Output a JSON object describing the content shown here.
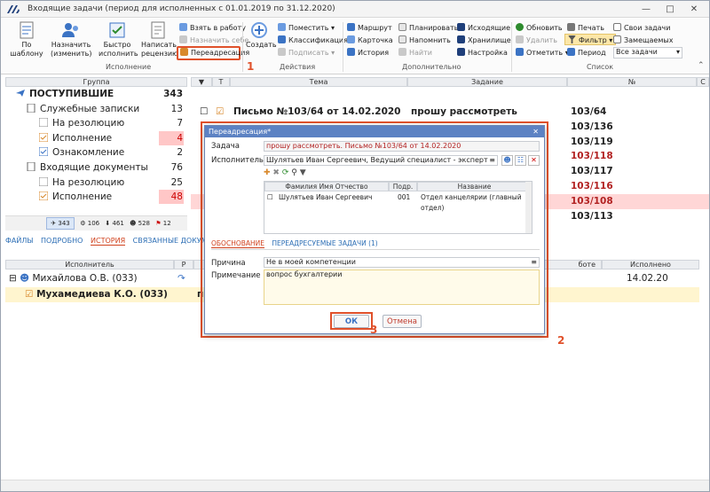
{
  "window": {
    "title": "Входящие задачи (период для исполненных с 01.01.2019 по 31.12.2020)"
  },
  "ribbon": {
    "execution": {
      "group_label": "Исполнение",
      "by_template": "По шаблону",
      "assign": "Назначить (изменить)",
      "quick_exec": "Быстро исполнить",
      "write_review": "Написать рецензию",
      "take_to_work": "Взять в работу",
      "assign_self": "Назначить себе",
      "readdress": "Переадресация"
    },
    "actions": {
      "group_label": "Действия",
      "create": "Создать",
      "place": "Поместить",
      "classify": "Классификация",
      "sign": "Подписать"
    },
    "additional": {
      "group_label": "Дополнительно",
      "route": "Маршрут",
      "card": "Карточка",
      "history": "История",
      "plan": "Планировать",
      "remind": "Напомнить",
      "find": "Найти",
      "outgoing": "Исходящие",
      "storage": "Хранилище",
      "settings": "Настройка"
    },
    "list": {
      "group_label": "Список",
      "refresh": "Обновить",
      "delete": "Удалить",
      "mark": "Отметить",
      "print": "Печать",
      "filter": "Фильтр",
      "period": "Период",
      "own_tasks": "Свои задачи",
      "substitutes": "Замещаемых",
      "all_tasks": "Все задачи"
    },
    "markers": {
      "one": "1",
      "two": "2",
      "three": "3"
    }
  },
  "tree": {
    "header": "Группа",
    "rows": [
      {
        "label": "ПОСТУПИВШИЕ",
        "count": "343"
      },
      {
        "label": "Служебные записки",
        "count": "13"
      },
      {
        "label": "На резолюцию",
        "count": "7"
      },
      {
        "label": "Исполнение",
        "count": "4"
      },
      {
        "label": "Ознакомление",
        "count": "2"
      },
      {
        "label": "Входящие документы",
        "count": "76"
      },
      {
        "label": "На резолюцию",
        "count": "25"
      },
      {
        "label": "Исполнение",
        "count": "48"
      }
    ],
    "bar": [
      "343",
      "106",
      "461",
      "528",
      "12"
    ]
  },
  "grid": {
    "headers": {
      "t": "Т",
      "topic": "Тема",
      "task": "Задание",
      "num": "№",
      "c": "С"
    },
    "rows": [
      {
        "topic": "Письмо №103/64 от 14.02.2020",
        "task": "прошу рассмотреть",
        "num": "103/64"
      },
      {
        "num": "103/136"
      },
      {
        "num": "103/119"
      },
      {
        "num": "103/118"
      },
      {
        "num": "103/117"
      },
      {
        "num": "103/116"
      },
      {
        "num": "103/108"
      },
      {
        "num": "103/113"
      }
    ]
  },
  "bottom": {
    "tabs": [
      "ФАЙЛЫ",
      "ПОДРОБНО",
      "ИСТОРИЯ",
      "СВЯЗАННЫЕ ДОКУМЕНТЫ"
    ],
    "headers": {
      "executor": "Исполнитель",
      "r": "Р",
      "work": "боте",
      "done": "Исполнено"
    },
    "rows": [
      {
        "executor": "Михайлова О.В. (033)",
        "done": "14.02.20"
      },
      {
        "executor": "Мухамедиева К.О. (033)",
        "tail": "п"
      }
    ]
  },
  "dialog": {
    "title": "Переадресация*",
    "task_label": "Задача",
    "task_value": "прошу рассмотреть. Письмо №103/64 от 14.02.2020",
    "executor_label": "Исполнитель",
    "executor_value": "Шулятьев Иван Сергеевич, Ведущий  специалист - эксперт",
    "table_headers": {
      "fio": "Фамилия Имя Отчество",
      "sub": "Подр.",
      "name": "Название"
    },
    "table_row": {
      "fio": "Шулятьев Иван Сергеевич",
      "sub": "001",
      "name": "Отдел канцелярии (главный отдел)"
    },
    "tabs": {
      "reason": "ОБОСНОВАНИЕ",
      "tasks": "ПЕРЕАДРЕСУЕМЫЕ ЗАДАЧИ (1)"
    },
    "reason_label": "Причина",
    "reason_value": "Не в моей компетенции",
    "note_label": "Примечание",
    "note_value": "вопрос бухгалтерии",
    "ok": "ОК",
    "cancel": "Отмена"
  }
}
